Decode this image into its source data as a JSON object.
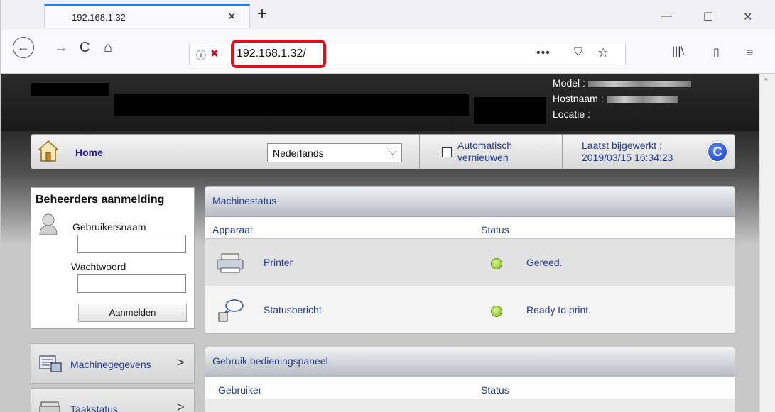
{
  "browser": {
    "tab_title": "192.168.1.32",
    "tab_close": "×",
    "new_tab": "+",
    "url": "192.168.1.32/",
    "url_dots": "•••",
    "minimize": "—",
    "maximize": "☐",
    "close": "✕"
  },
  "header": {
    "model_label": "Model :",
    "hostname_label": "Hostnaam :",
    "location_label": "Locatie :"
  },
  "topbar": {
    "home_label": "Home",
    "language_selected": "Nederlands",
    "auto_refresh_label_1": "Automatisch",
    "auto_refresh_label_2": "vernieuwen",
    "auto_refresh_checked": false,
    "last_updated_label": "Laatst bijgewerkt :",
    "last_updated_value": "2019/03/15 16:34:23"
  },
  "login": {
    "title": "Beheerders aanmelding",
    "username_label": "Gebruikersnaam",
    "username_value": "",
    "password_label": "Wachtwoord",
    "password_value": "",
    "button_label": "Aanmelden"
  },
  "sidebar": {
    "items": [
      {
        "label": "Machinegegevens",
        "icon": "machine-info-icon",
        "arrow": ">"
      },
      {
        "label": "Taakstatus",
        "icon": "job-status-icon",
        "arrow": ">"
      }
    ]
  },
  "machine_status": {
    "title": "Machinestatus",
    "columns": [
      "Apparaat",
      "Status"
    ],
    "rows": [
      {
        "device": "Printer",
        "status": "Gereed.",
        "status_color": "#8cc63f"
      },
      {
        "device": "Statusbericht",
        "status": "Ready to print.",
        "status_color": "#8cc63f"
      }
    ]
  },
  "panel_usage": {
    "title": "Gebruik bedieningspaneel",
    "columns": [
      "Gebruiker",
      "Status"
    ]
  },
  "colors": {
    "url_highlight": "#e10c1a",
    "link": "#1a1ab0",
    "label": "#1f3c8f",
    "status_ok": "#8cc63f"
  }
}
